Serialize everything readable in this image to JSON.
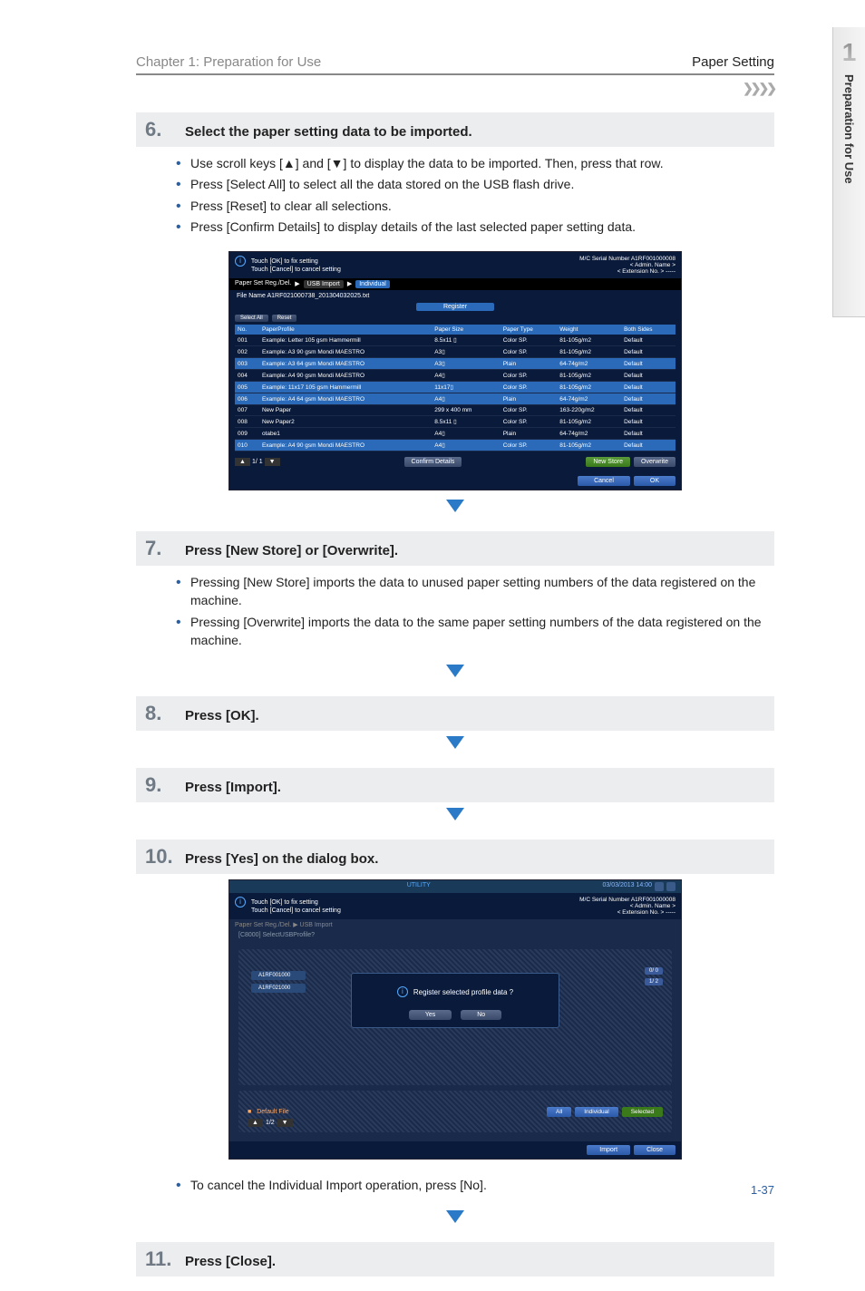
{
  "sideTab": {
    "num": "1",
    "label": "Preparation for Use"
  },
  "header": {
    "chapter": "Chapter 1: Preparation for Use",
    "section": "Paper Setting"
  },
  "step6": {
    "num": "6.",
    "title": "Select the paper setting data to be imported.",
    "bullets": [
      "Use scroll keys [▲] and [▼] to display the data to be imported. Then, press that row.",
      "Press [Select All] to select all the data stored on the USB flash drive.",
      "Press [Reset] to clear all selections.",
      "Press [Confirm Details] to display details of the last selected paper setting data."
    ]
  },
  "step7": {
    "num": "7.",
    "title": "Press [New Store] or [Overwrite].",
    "bullets": [
      "Pressing [New Store] imports the data to unused paper setting numbers of the data registered on the machine.",
      "Pressing [Overwrite] imports the data to the same paper setting numbers of the data registered on the machine."
    ]
  },
  "step8": {
    "num": "8.",
    "title": "Press [OK]."
  },
  "step9": {
    "num": "9.",
    "title": "Press [Import]."
  },
  "step10": {
    "num": "10.",
    "title": "Press [Yes] on the dialog box."
  },
  "step10after": {
    "bullets": [
      "To cancel the Individual Import operation, press [No]."
    ]
  },
  "step11": {
    "num": "11.",
    "title": "Press [Close]."
  },
  "pageNum": "1-37",
  "scr1": {
    "msg1": "Touch [OK] to fix setting",
    "msg2": "Touch [Cancel] to cancel setting",
    "serial": "M/C Serial Number   A1RF001000008",
    "admin": "< Admin. Name >",
    "ext": "< Extension No. >  -----",
    "crumb": [
      "Paper Set Reg./Del.",
      "▶",
      "USB Import",
      "▶",
      "Individual"
    ],
    "fileName": "File Name  A1RF021000738_201304032025.txt",
    "regTab": "Register",
    "toolbar": [
      "Select All",
      "Reset"
    ],
    "headers": [
      "No.",
      "PaperProfile",
      "Paper Size",
      "Paper Type",
      "Weight",
      "Both Sides"
    ],
    "rows": [
      {
        "sel": false,
        "cells": [
          "001",
          "Example: Letter 105 gsm Hammermill",
          "8.5x11 ▯",
          "Color SP.",
          "81-105g/m2",
          "Default"
        ]
      },
      {
        "sel": false,
        "cells": [
          "002",
          "Example: A3 90 gsm Mondi MAESTRO",
          "A3▯",
          "Color SP.",
          "81-105g/m2",
          "Default"
        ]
      },
      {
        "sel": true,
        "cells": [
          "003",
          "Example: A3 64 gsm Mondi MAESTRO",
          "A3▯",
          "Plain",
          "64-74g/m2",
          "Default"
        ]
      },
      {
        "sel": false,
        "cells": [
          "004",
          "Example: A4 90 gsm Mondi MAESTRO",
          "A4▯",
          "Color SP.",
          "81-105g/m2",
          "Default"
        ]
      },
      {
        "sel": true,
        "cells": [
          "005",
          "Example: 11x17 105 gsm Hammermill",
          "11x17▯",
          "Color SP.",
          "81-105g/m2",
          "Default"
        ]
      },
      {
        "sel": true,
        "cells": [
          "006",
          "Example: A4 64 gsm Mondi MAESTRO",
          "A4▯",
          "Plain",
          "64-74g/m2",
          "Default"
        ]
      },
      {
        "sel": false,
        "cells": [
          "007",
          "New Paper",
          "299 x  400 mm",
          "Color SP.",
          "163-220g/m2",
          "Default"
        ]
      },
      {
        "sel": false,
        "cells": [
          "008",
          "New Paper2",
          "8.5x11 ▯",
          "Color SP.",
          "81-105g/m2",
          "Default"
        ]
      },
      {
        "sel": false,
        "cells": [
          "009",
          "otabe1",
          "A4▯",
          "Plain",
          "64-74g/m2",
          "Default"
        ]
      },
      {
        "sel": true,
        "cells": [
          "010",
          "Example: A4 90 gsm Mondi MAESTRO",
          "A4▯",
          "Color SP.",
          "81-105g/m2",
          "Default"
        ]
      }
    ],
    "navPage": "1/  1",
    "confirmBtn": "Confirm Details",
    "newStore": "New Store",
    "overwrite": "Overwrite",
    "cancel": "Cancel",
    "ok": "OK"
  },
  "scr2": {
    "utility": "UTILITY",
    "datetime": "03/03/2013 14:00",
    "msg1": "Touch [OK] to fix setting",
    "msg2": "Touch [Cancel] to cancel setting",
    "serial": "M/C Serial Number   A1RF001000008",
    "admin": "< Admin. Name >",
    "ext": "< Extension No. >  -----",
    "crumb": "Paper Set Reg./Del.   ▶   USB Import",
    "sub": "[C8000] SelectUSBProfile?",
    "leftLabels": [
      "A1RF001000",
      "A1RF021000"
    ],
    "dialogMsg": "Register selected profile data ?",
    "yes": "Yes",
    "no": "No",
    "rInd": [
      "0/ 0",
      "1/ 2"
    ],
    "defaultFile": "Default File",
    "allBtn": "All",
    "individual": "Individual",
    "selected": "Selected",
    "navPage": "1/2",
    "import": "Import",
    "close": "Close"
  }
}
